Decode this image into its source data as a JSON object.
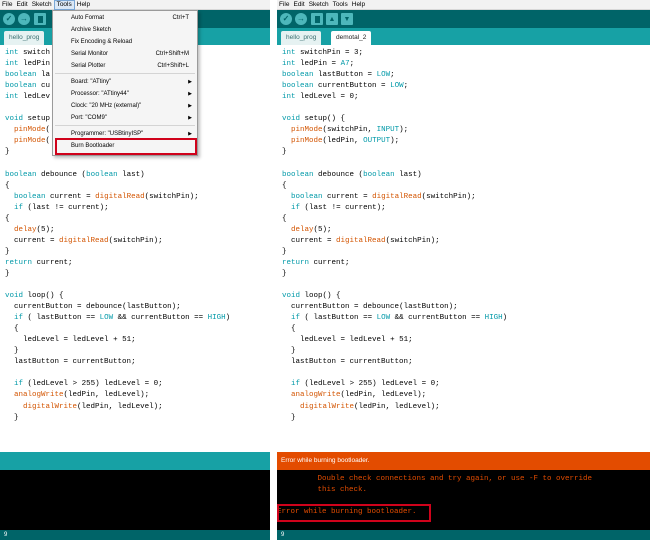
{
  "menubar": {
    "left": [
      "File",
      "Edit",
      "Sketch",
      "Tools",
      "Help"
    ],
    "right": [
      "File",
      "Edit",
      "Sketch",
      "Tools",
      "Help"
    ]
  },
  "toolbar": {
    "verify": "✓",
    "upload": "→"
  },
  "tabs": {
    "left": "hello_prog",
    "right_inactive": "hello_prog",
    "right_active": "demotal_2"
  },
  "tools_menu": {
    "items": [
      {
        "label": "Auto Format",
        "shortcut": "Ctrl+T",
        "submenu": false
      },
      {
        "label": "Archive Sketch",
        "shortcut": "",
        "submenu": false
      },
      {
        "label": "Fix Encoding & Reload",
        "shortcut": "",
        "submenu": false
      },
      {
        "label": "Serial Monitor",
        "shortcut": "Ctrl+Shift+M",
        "submenu": false
      },
      {
        "label": "Serial Plotter",
        "shortcut": "Ctrl+Shift+L",
        "submenu": false
      },
      {
        "label": "Board: \"ATtiny\"",
        "shortcut": "",
        "submenu": true
      },
      {
        "label": "Processor: \"ATtiny44\"",
        "shortcut": "",
        "submenu": true
      },
      {
        "label": "Clock: \"20 MHz (external)\"",
        "shortcut": "",
        "submenu": true
      },
      {
        "label": "Port: \"COM9\"",
        "shortcut": "",
        "submenu": true
      },
      {
        "label": "Programmer: \"USBtinyISP\"",
        "shortcut": "",
        "submenu": true
      },
      {
        "label": "Burn Bootloader",
        "shortcut": "",
        "submenu": false
      }
    ]
  },
  "code_right": [
    "int switchPin = 3;",
    "int ledPin = A7;",
    "boolean lastButton = LOW;",
    "boolean currentButton = LOW;",
    "int ledLevel = 0;",
    "",
    "void setup() {",
    "  pinMode(switchPin, INPUT);",
    "  pinMode(ledPin, OUTPUT);",
    "}",
    "",
    "boolean debounce (boolean last)",
    "{",
    "  boolean current = digitalRead(switchPin);",
    "  if (last != current);",
    "{",
    "  delay(5);",
    "  current = digitalRead(switchPin);",
    "}",
    "return current;",
    "}",
    "",
    "void loop() {",
    "  currentButton = debounce(lastButton);",
    "  if ( lastButton == LOW && currentButton == HIGH)",
    "  {",
    "    ledLevel = ledLevel + 51;",
    "  }",
    "  lastButton = currentButton;",
    "",
    "  if (ledLevel > 255) ledLevel = 0;",
    "  analogWrite(ledPin, ledLevel);",
    "    digitalWrite(ledPin, ledLevel);",
    "  }"
  ],
  "code_left": [
    "int switch",
    "int ledPin",
    "boolean la",
    "boolean cu",
    "int ledLev",
    "",
    "void setup",
    "  pinMode(",
    "  pinMode(",
    "}",
    "",
    "boolean debounce (boolean last)",
    "{",
    "  boolean current = digitalRead(switchPin);",
    "  if (last != current);",
    "{",
    "  delay(5);",
    "  current = digitalRead(switchPin);",
    "}",
    "return current;",
    "}",
    "",
    "void loop() {",
    "  currentButton = debounce(lastButton);",
    "  if ( lastButton == LOW && currentButton == HIGH)",
    "  {",
    "    ledLevel = ledLevel + 51;",
    "  }",
    "  lastButton = currentButton;",
    "",
    "  if (ledLevel > 255) ledLevel = 0;",
    "  analogWrite(ledPin, ledLevel);",
    "    digitalWrite(ledPin, ledLevel);",
    "  }"
  ],
  "console": {
    "header_error": "Error while burning bootloader.",
    "lines": [
      "         Double check connections and try again, or use -F to override",
      "         this check.",
      "",
      "Error while burning bootloader."
    ]
  },
  "status": {
    "left": "9",
    "right": "9"
  },
  "colors": {
    "teal_dark": "#006468",
    "teal_tab": "#17a1a5",
    "error_orange": "#e34c00",
    "keyword": "#0099a8",
    "function": "#d35400",
    "highlight_red": "#d0021b"
  }
}
